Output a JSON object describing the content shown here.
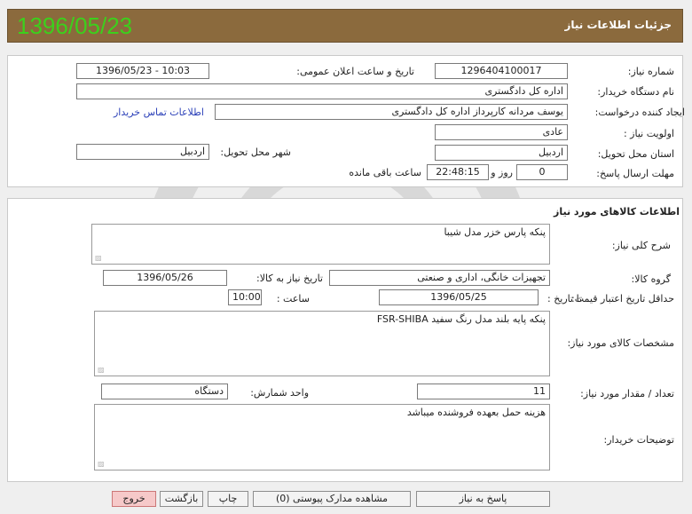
{
  "header": {
    "title": "جزئیات اطلاعات نیاز",
    "date": "1396/05/23"
  },
  "info": {
    "need_number_label": "شماره نیاز:",
    "need_number": "1296404100017",
    "announce_label": "تاریخ و ساعت اعلان عمومی:",
    "announce_value": "1396/05/23 - 10:03",
    "buyer_org_label": "نام دستگاه خریدار:",
    "buyer_org": "اداره کل دادگستری",
    "creator_label": "ایجاد کننده درخواست:",
    "creator": "یوسف  مردانه  کارپرداز اداره کل دادگستری",
    "contact_link": "اطلاعات تماس خریدار",
    "priority_label": "اولویت نیاز :",
    "priority": "عادی",
    "province_label": "استان محل تحویل:",
    "province": "اردبیل",
    "city_label": "شهر محل تحویل:",
    "city": "اردبیل",
    "deadline_label": "مهلت ارسال پاسخ:",
    "deadline_days": "0",
    "days_word": "روز و",
    "deadline_time": "22:48:15",
    "remaining_label": "ساعت باقی مانده"
  },
  "goods": {
    "section_title": "اطلاعات کالاهای مورد نیاز",
    "general_desc_label": "شرح کلی نیاز:",
    "general_desc": "پنکه پارس خزر مدل شیبا",
    "group_label": "گروه کالا:",
    "group": "تجهیزات خانگی، اداری و صنعتی",
    "need_date_label": "تاریخ نیاز به کالا:",
    "need_date": "1396/05/26",
    "min_validity_label": "حداقل تاریخ اعتبار قیمت:",
    "until_date_label": "تا تاریخ :",
    "until_date": "1396/05/25",
    "hour_label": "ساعت :",
    "hour": "10:00",
    "specs_label": "مشخصات کالای مورد نیاز:",
    "specs": "پنکه پایه بلند مدل رنگ سفید FSR-SHIBA",
    "qty_label": "تعداد / مقدار مورد نیاز:",
    "qty": "11",
    "unit_label": "واحد شمارش:",
    "unit": "دستگاه",
    "buyer_notes_label": "توضیحات خریدار:",
    "buyer_notes": "هزینه حمل بعهده فروشنده میباشد"
  },
  "buttons": {
    "respond": "پاسخ به نیاز",
    "attachments": "مشاهده مدارک پیوستی (0)",
    "print": "چاپ",
    "back": "بازگشت",
    "exit": "خروج"
  },
  "colors": {
    "header_bg": "#8b6a3d",
    "header_date": "#3cd01c",
    "link": "#2a3fb8",
    "exit_button": "#f6c9c9"
  }
}
